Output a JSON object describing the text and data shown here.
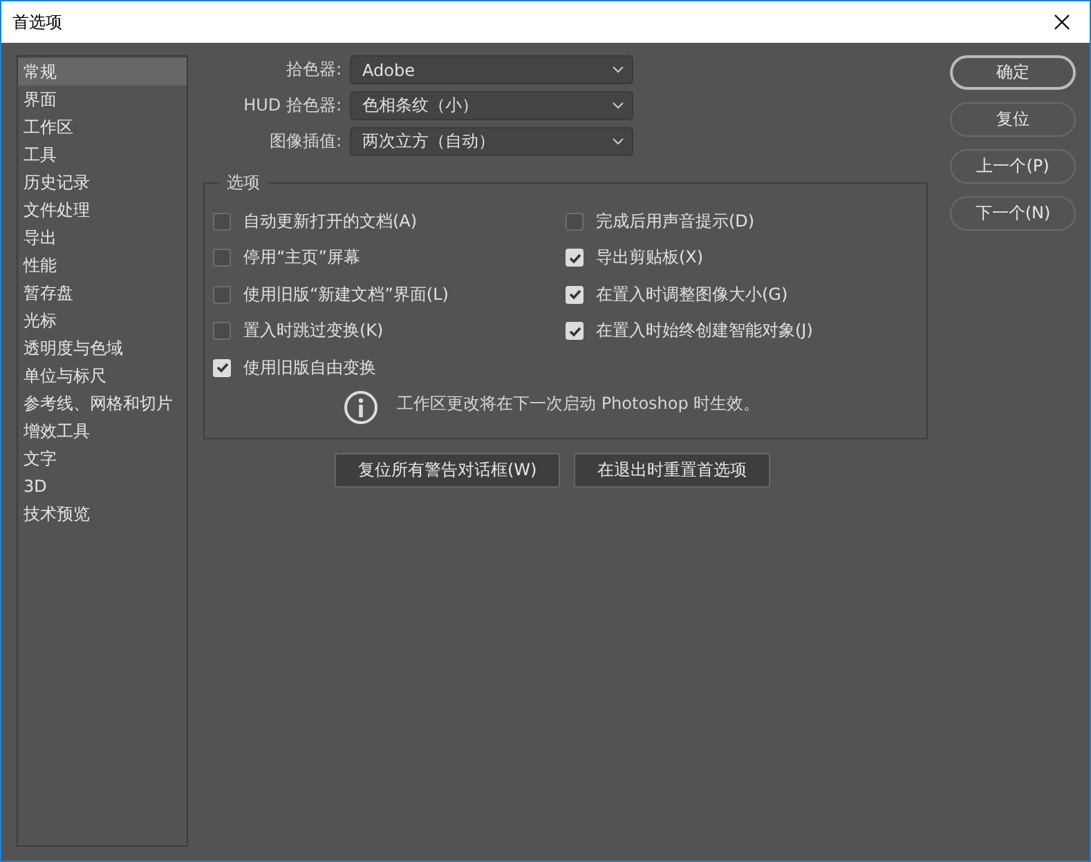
{
  "window": {
    "title": "首选项"
  },
  "sidebar": {
    "items": [
      {
        "label": "常规",
        "selected": true
      },
      {
        "label": "界面",
        "selected": false
      },
      {
        "label": "工作区",
        "selected": false
      },
      {
        "label": "工具",
        "selected": false
      },
      {
        "label": "历史记录",
        "selected": false
      },
      {
        "label": "文件处理",
        "selected": false
      },
      {
        "label": "导出",
        "selected": false
      },
      {
        "label": "性能",
        "selected": false
      },
      {
        "label": "暂存盘",
        "selected": false
      },
      {
        "label": "光标",
        "selected": false
      },
      {
        "label": "透明度与色域",
        "selected": false
      },
      {
        "label": "单位与标尺",
        "selected": false
      },
      {
        "label": "参考线、网格和切片",
        "selected": false
      },
      {
        "label": "增效工具",
        "selected": false
      },
      {
        "label": "文字",
        "selected": false
      },
      {
        "label": "3D",
        "selected": false
      },
      {
        "label": "技术预览",
        "selected": false
      }
    ]
  },
  "fields": [
    {
      "label": "拾色器:",
      "value": "Adobe"
    },
    {
      "label": "HUD 拾色器:",
      "value": "色相条纹（小）"
    },
    {
      "label": "图像插值:",
      "value": "两次立方（自动）"
    }
  ],
  "options": {
    "title": "选项",
    "columns": [
      [
        {
          "label": "自动更新打开的文档(A)",
          "checked": false
        },
        {
          "label": "停用“主页”屏幕",
          "checked": false
        },
        {
          "label": "使用旧版“新建文档”界面(L)",
          "checked": false
        },
        {
          "label": "置入时跳过变换(K)",
          "checked": false
        },
        {
          "label": "使用旧版自由变换",
          "checked": true
        }
      ],
      [
        {
          "label": "完成后用声音提示(D)",
          "checked": false
        },
        {
          "label": "导出剪贴板(X)",
          "checked": true
        },
        {
          "label": "在置入时调整图像大小(G)",
          "checked": true
        },
        {
          "label": "在置入时始终创建智能对象(J)",
          "checked": true
        }
      ]
    ],
    "note": "工作区更改将在下一次启动 Photoshop 时生效。"
  },
  "actions": [
    "复位所有警告对话框(W)",
    "在退出时重置首选项"
  ],
  "buttons": [
    {
      "label": "确定",
      "kind": "default"
    },
    {
      "label": "复位",
      "kind": "normal"
    },
    {
      "label": "上一个(P)",
      "kind": "normal"
    },
    {
      "label": "下一个(N)",
      "kind": "normal"
    }
  ]
}
